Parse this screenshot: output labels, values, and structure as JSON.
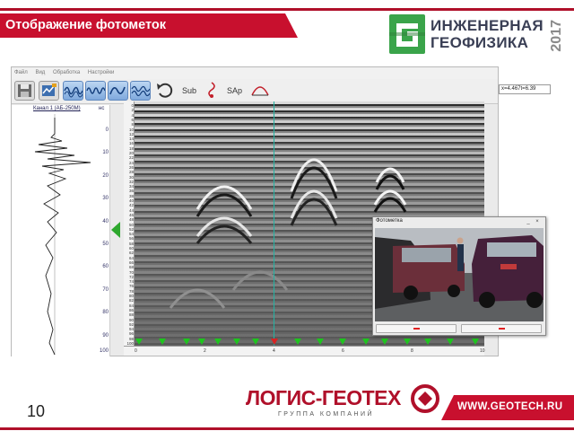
{
  "slide": {
    "title": "Отображение фотометок",
    "logo_top": {
      "line1": "ИНЖЕНЕРНАЯ",
      "line2": "ГЕОФИЗИКА",
      "year": "2017"
    },
    "page_number": "10",
    "footer_brand": "ЛОГИС-ГЕОТЕХ",
    "footer_sub": "ГРУППА КОМПАНИЙ",
    "website": "WWW.GEOTECH.RU"
  },
  "app": {
    "menu": [
      "Файл",
      "Вид",
      "Обработка",
      "Настройки"
    ],
    "toolbar": {
      "buttons": [
        {
          "name": "save",
          "icon": "floppy-icon"
        },
        {
          "name": "open",
          "icon": "folder-icon"
        },
        {
          "name": "wave1",
          "icon": "wave-icon"
        },
        {
          "name": "wave2",
          "icon": "wave-icon"
        },
        {
          "name": "wave3",
          "icon": "wave-icon"
        },
        {
          "name": "wave4",
          "icon": "wave-icon"
        },
        {
          "name": "undo",
          "icon": "undo-icon"
        }
      ],
      "sub_label": "Sub",
      "sap_label": "SAp"
    },
    "coord_readout": "x=4.467t=6.39",
    "trace_panel": {
      "channel": "Канал 1 (АБ-250М)",
      "unit": "нс",
      "ticks": [
        "0",
        "10",
        "20",
        "30",
        "40",
        "50",
        "60",
        "70",
        "80",
        "90",
        "100"
      ]
    },
    "depth_ticks": [
      "0",
      "2",
      "4",
      "6",
      "8",
      "10",
      "12",
      "14",
      "16",
      "18",
      "20",
      "22",
      "24",
      "26",
      "28",
      "30",
      "32",
      "34",
      "36",
      "38",
      "40",
      "42",
      "44",
      "46",
      "48",
      "50",
      "52",
      "54",
      "56",
      "58",
      "60",
      "62",
      "64",
      "66",
      "68",
      "70",
      "72",
      "74",
      "76",
      "78",
      "80",
      "82",
      "84",
      "86",
      "88",
      "90",
      "92",
      "94",
      "96",
      "98",
      "100"
    ],
    "distance_ticks": [
      "0",
      "2",
      "4",
      "6",
      "8",
      "10"
    ],
    "photo_window": {
      "title": "Фотометка"
    }
  }
}
